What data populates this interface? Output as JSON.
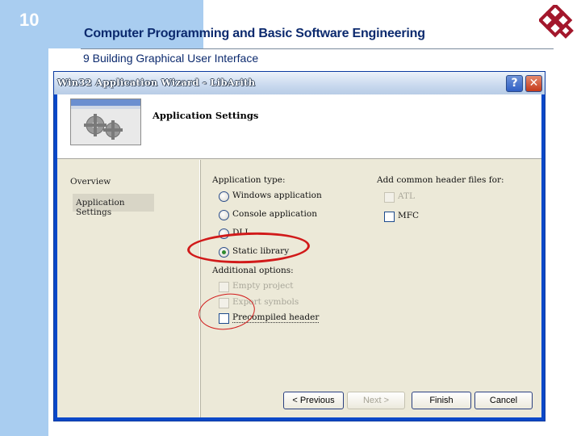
{
  "slide": {
    "number": "10",
    "title": "Computer Programming and Basic Software Engineering",
    "subtitle": "9 Building Graphical User Interface",
    "logo_icon": "polyu-logo-icon"
  },
  "dialog": {
    "title": "Win32 Application Wizard - LibArith",
    "help_label": "?",
    "close_label": "✕",
    "header_title": "Application Settings",
    "nav": {
      "overview": "Overview",
      "app_settings": "Application Settings"
    },
    "app_type_label": "Application type:",
    "app_types": [
      {
        "label": "Windows application",
        "checked": false
      },
      {
        "label": "Console application",
        "checked": false
      },
      {
        "label": "DLL",
        "checked": false
      },
      {
        "label": "Static library",
        "checked": true
      }
    ],
    "additional_label": "Additional options:",
    "additional": [
      {
        "label": "Empty project",
        "enabled": false
      },
      {
        "label": "Export symbols",
        "enabled": false
      },
      {
        "label": "Precompiled header",
        "enabled": true
      }
    ],
    "headers_label": "Add common header files for:",
    "headers": [
      {
        "label": "ATL",
        "enabled": false
      },
      {
        "label": "MFC",
        "enabled": true
      }
    ],
    "buttons": {
      "previous": "< Previous",
      "next": "Next >",
      "finish": "Finish",
      "cancel": "Cancel"
    },
    "colors": {
      "annotation": "#d11a1a",
      "titlebar_text": "#ffffff",
      "title_blue": "#0c2a6e"
    }
  }
}
